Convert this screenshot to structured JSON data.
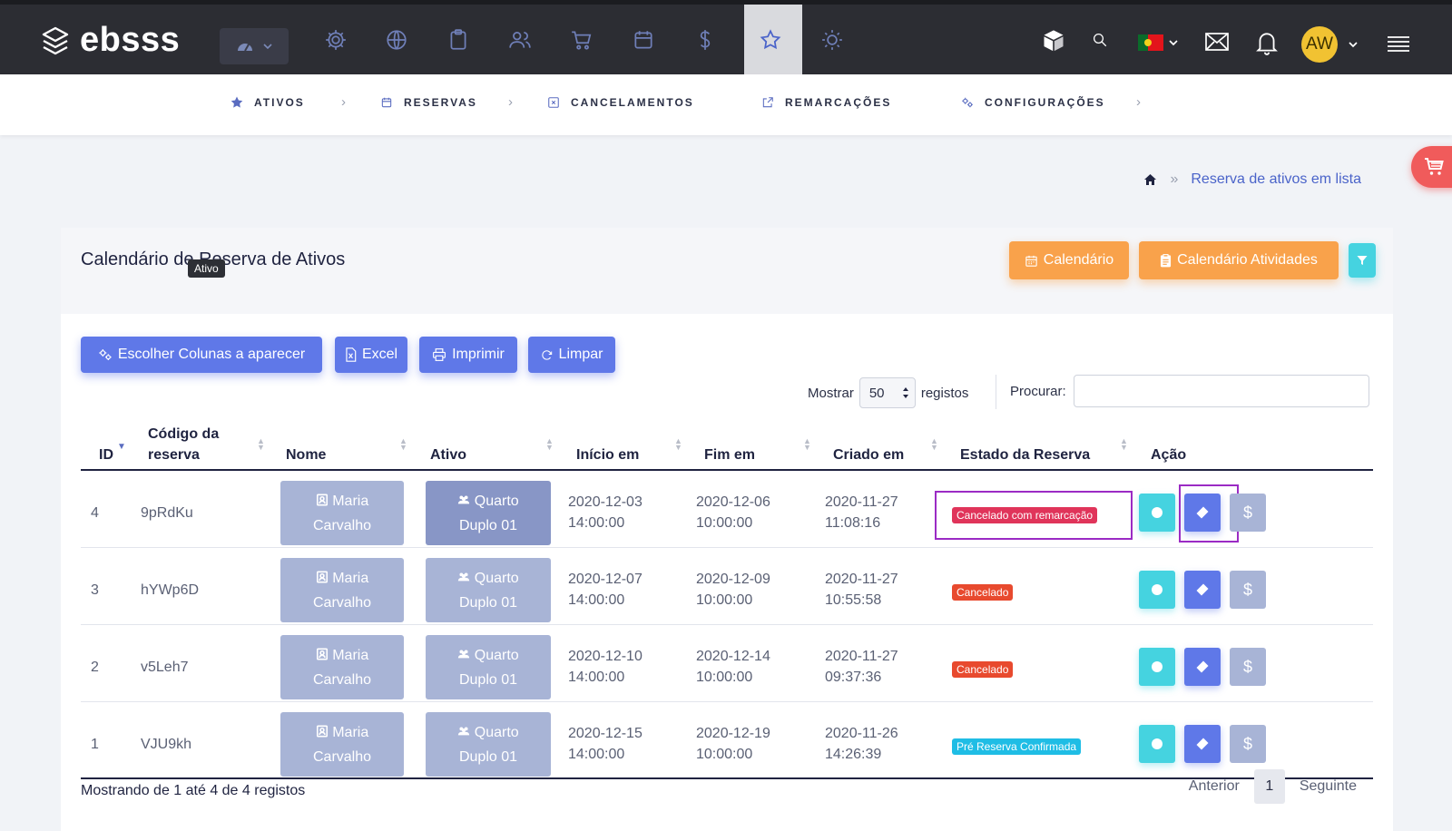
{
  "brand": {
    "name": "ebsss"
  },
  "topbar": {
    "avatar_initials": "AW",
    "icons": [
      "dashboard-icon",
      "gear-icon",
      "globe-icon",
      "clipboard-icon",
      "users-icon",
      "cart-icon",
      "calendar-icon",
      "dollar-icon",
      "star-icon",
      "sun-icon"
    ],
    "accent": "#6f7fb8"
  },
  "subnav": {
    "items": [
      {
        "label": "ATIVOS",
        "icon": "star-icon"
      },
      {
        "label": "RESERVAS",
        "icon": "calendar-icon"
      },
      {
        "label": "CANCELAMENTOS",
        "icon": "cancel-icon"
      },
      {
        "label": "REMARCAÇÕES",
        "icon": "reschedule-icon"
      },
      {
        "label": "CONFIGURAÇÕES",
        "icon": "gears-icon"
      }
    ]
  },
  "breadcrumb": {
    "current": "Reserva de ativos em lista"
  },
  "card": {
    "title": "Calendário de Reserva de Ativos",
    "tooltip": "Ativo",
    "calendar_btn": "Calendário",
    "activities_btn": "Calendário Atividades"
  },
  "toolbar": {
    "columns_btn": "Escolher Colunas a aparecer",
    "excel_btn": "Excel",
    "print_btn": "Imprimir",
    "clear_btn": "Limpar"
  },
  "length": {
    "prefix": "Mostrar",
    "value": "50",
    "suffix": "registos"
  },
  "search": {
    "label": "Procurar:",
    "value": ""
  },
  "table": {
    "headers": {
      "id": "ID",
      "code_line1": "Código da",
      "code_line2": "reserva",
      "name": "Nome",
      "asset": "Ativo",
      "start": "Início em",
      "end": "Fim em",
      "created": "Criado em",
      "status": "Estado da Reserva",
      "action": "Ação"
    },
    "rows": [
      {
        "id": "4",
        "code": "9pRdKu",
        "name1": "Maria",
        "name2": "Carvalho",
        "asset1": "Quarto",
        "asset2": "Duplo 01",
        "start_d": "2020-12-03",
        "start_t": "14:00:00",
        "end_d": "2020-12-06",
        "end_t": "10:00:00",
        "created_d": "2020-11-27",
        "created_t": "11:08:16",
        "status": "Cancelado com remarcação"
      },
      {
        "id": "3",
        "code": "hYWp6D",
        "name1": "Maria",
        "name2": "Carvalho",
        "asset1": "Quarto",
        "asset2": "Duplo 01",
        "start_d": "2020-12-07",
        "start_t": "14:00:00",
        "end_d": "2020-12-09",
        "end_t": "10:00:00",
        "created_d": "2020-11-27",
        "created_t": "10:55:58",
        "status": "Cancelado"
      },
      {
        "id": "2",
        "code": "v5Leh7",
        "name1": "Maria",
        "name2": "Carvalho",
        "asset1": "Quarto",
        "asset2": "Duplo 01",
        "start_d": "2020-12-10",
        "start_t": "14:00:00",
        "end_d": "2020-12-14",
        "end_t": "10:00:00",
        "created_d": "2020-11-27",
        "created_t": "09:37:36",
        "status": "Cancelado"
      },
      {
        "id": "1",
        "code": "VJU9kh",
        "name1": "Maria",
        "name2": "Carvalho",
        "asset1": "Quarto",
        "asset2": "Duplo 01",
        "start_d": "2020-12-15",
        "start_t": "14:00:00",
        "end_d": "2020-12-19",
        "end_t": "10:00:00",
        "created_d": "2020-11-26",
        "created_t": "14:26:39",
        "status": "Pré Reserva Confirmada"
      }
    ],
    "dollar_glyph": "$"
  },
  "footer": {
    "info": "Mostrando de 1 até 4 de 4 registos",
    "prev": "Anterior",
    "page": "1",
    "next": "Seguinte"
  }
}
